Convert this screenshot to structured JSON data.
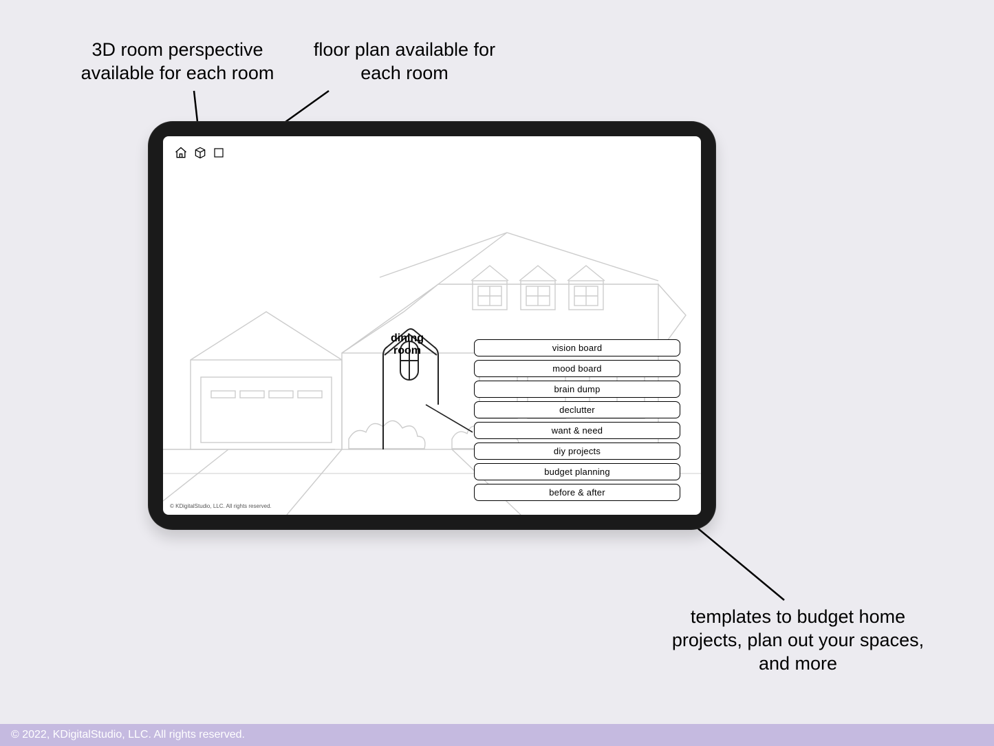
{
  "callouts": {
    "three_d": "3D room perspective available for each room",
    "floor_plan": "floor plan available for each room",
    "templates": "templates to budget home projects, plan out your spaces, and more"
  },
  "room_label_line1": "dining",
  "room_label_line2": "room",
  "menu": {
    "items": [
      {
        "label": "vision board"
      },
      {
        "label": "mood board"
      },
      {
        "label": "brain dump"
      },
      {
        "label": "declutter"
      },
      {
        "label": "want & need"
      },
      {
        "label": "diy projects"
      },
      {
        "label": "budget planning"
      },
      {
        "label": "before & after"
      }
    ]
  },
  "screen_copyright": "© KDigitalStudio, LLC. All rights reserved.",
  "footer": "© 2022, KDigitalStudio, LLC. All rights reserved."
}
